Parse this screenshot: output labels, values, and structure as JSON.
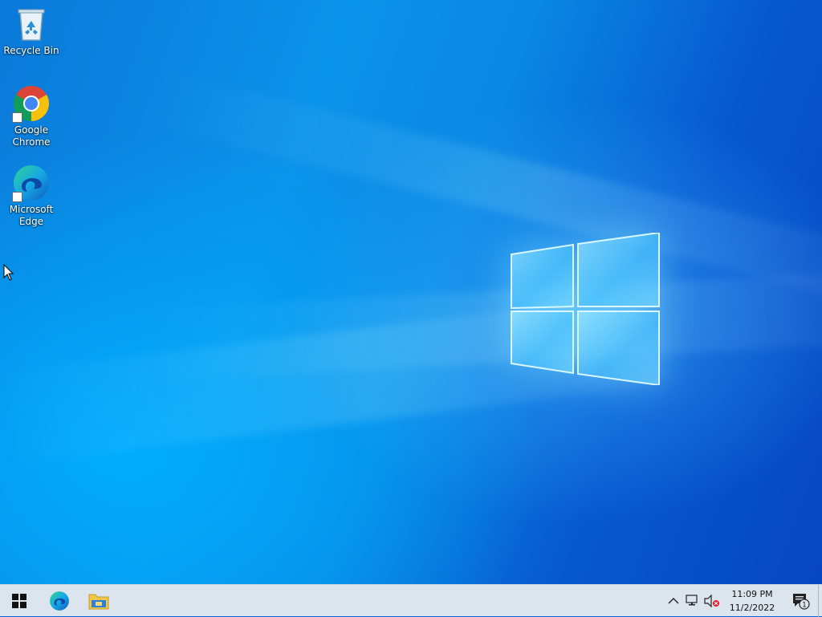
{
  "desktop": {
    "icons": [
      {
        "label": "Recycle Bin",
        "icon": "recycle-bin-icon"
      },
      {
        "label": "Google Chrome",
        "icon": "chrome-icon"
      },
      {
        "label": "Microsoft Edge",
        "icon": "edge-icon"
      }
    ],
    "colors": {
      "wallpaper_primary": "#0a93ea",
      "wallpaper_deep": "#0646c2",
      "logo_glow": "#8ce6ff"
    }
  },
  "taskbar": {
    "buttons": [
      {
        "name": "start-button",
        "icon": "windows-logo-icon"
      },
      {
        "name": "edge-taskbar-button",
        "icon": "edge-icon"
      },
      {
        "name": "file-explorer-button",
        "icon": "folder-icon"
      }
    ],
    "tray": {
      "icons": [
        "chevron-up-icon",
        "network-icon",
        "volume-muted-icon"
      ],
      "time": "11:09 PM",
      "date": "11/2/2022",
      "notification_count": "1"
    },
    "colors": {
      "background": "#dce5ee"
    }
  }
}
